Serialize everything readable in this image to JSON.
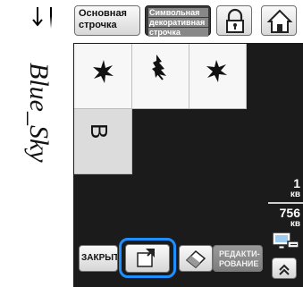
{
  "toolbar": {
    "standard_stitch_line1": "Основная",
    "standard_stitch_line2": "строчка",
    "char_deco_line1": "Символьная",
    "char_deco_line2": "декоративная",
    "char_deco_line3": "строчка"
  },
  "preview_text": "Blue_Sky",
  "grid": {
    "cells": [
      {
        "name": "stitch-pattern-star-1"
      },
      {
        "name": "stitch-pattern-pine"
      },
      {
        "name": "stitch-pattern-star-2"
      },
      {
        "name": "stitch-pattern-letter-b",
        "glyph": "B",
        "selected": true
      }
    ]
  },
  "counters": {
    "top_value": "1",
    "top_unit": "кв",
    "bottom_value": "756",
    "bottom_unit": "кв"
  },
  "bottom": {
    "close_label": "ЗАКРЫТЬ",
    "edit_line1": "РЕДАКТИ-",
    "edit_line2": "РОВАНИЕ"
  },
  "colors": {
    "highlight": "#1e8fff",
    "panel": "#1b1b1b"
  }
}
